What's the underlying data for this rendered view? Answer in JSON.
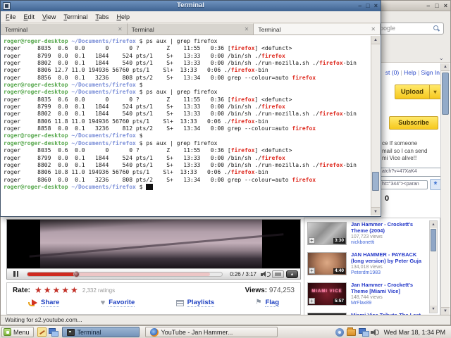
{
  "terminal": {
    "title": "Terminal",
    "menu_items": [
      "File",
      "Edit",
      "View",
      "Terminal",
      "Tabs",
      "Help"
    ],
    "tabs": [
      {
        "label": "Terminal"
      },
      {
        "label": "Terminal"
      },
      {
        "label": "Terminal"
      }
    ],
    "lines": [
      [
        [
          "roger@roger-desktop",
          "g"
        ],
        [
          " ",
          ""
        ],
        [
          "~/Documents/firefox",
          "b"
        ],
        [
          " $ ps aux | grep firefox",
          ""
        ]
      ],
      [
        [
          "roger     8035  0.6  0.0      0      0 ?        Z    11:55   0:36 [",
          ""
        ],
        [
          "firefox",
          "r"
        ],
        [
          "] <defunct>",
          ""
        ]
      ],
      [
        [
          "roger     8799  0.0  0.1   1844    524 pts/1    S+   13:33   0:00 /bin/sh ./",
          ""
        ],
        [
          "firefox",
          "r"
        ]
      ],
      [
        [
          "roger     8802  0.0  0.1   1844    540 pts/1    S+   13:33   0:00 /bin/sh ./run-mozilla.sh ./",
          ""
        ],
        [
          "firefox",
          "r"
        ],
        [
          "-bin",
          ""
        ]
      ],
      [
        [
          "roger     8806 12.7 11.0 194936 56760 pts/1    Sl+  13:33   0:06 ./",
          ""
        ],
        [
          "firefox",
          "r"
        ],
        [
          "-bin",
          ""
        ]
      ],
      [
        [
          "roger     8856  0.0  0.1   3236    808 pts/2    S+   13:34   0:00 grep --colour=auto ",
          ""
        ],
        [
          "firefox",
          "r"
        ]
      ],
      [
        [
          "roger@roger-desktop",
          "g"
        ],
        [
          " ",
          ""
        ],
        [
          "~/Documents/firefox",
          "b"
        ],
        [
          " $",
          ""
        ]
      ],
      [
        [
          "roger@roger-desktop",
          "g"
        ],
        [
          " ",
          ""
        ],
        [
          "~/Documents/firefox",
          "b"
        ],
        [
          " $ ps aux | grep firefox",
          ""
        ]
      ],
      [
        [
          "roger     8035  0.6  0.0      0      0 ?        Z    11:55   0:36 [",
          ""
        ],
        [
          "firefox",
          "r"
        ],
        [
          "] <defunct>",
          ""
        ]
      ],
      [
        [
          "roger     8799  0.0  0.1   1844    524 pts/1    S+   13:33   0:00 /bin/sh ./",
          ""
        ],
        [
          "firefox",
          "r"
        ]
      ],
      [
        [
          "roger     8802  0.0  0.1   1844    540 pts/1    S+   13:33   0:00 /bin/sh ./run-mozilla.sh ./",
          ""
        ],
        [
          "firefox",
          "r"
        ],
        [
          "-bin",
          ""
        ]
      ],
      [
        [
          "roger     8806 11.8 11.0 194936 56760 pts/1    Sl+  13:33   0:06 ./",
          ""
        ],
        [
          "firefox",
          "r"
        ],
        [
          "-bin",
          ""
        ]
      ],
      [
        [
          "roger     8858  0.0  0.1   3236    812 pts/2    S+   13:34   0:00 grep --colour=auto ",
          ""
        ],
        [
          "firefox",
          "r"
        ]
      ],
      [
        [
          "roger@roger-desktop",
          "g"
        ],
        [
          " ",
          ""
        ],
        [
          "~/Documents/firefox",
          "b"
        ],
        [
          " $",
          ""
        ]
      ],
      [
        [
          "roger@roger-desktop",
          "g"
        ],
        [
          " ",
          ""
        ],
        [
          "~/Documents/firefox",
          "b"
        ],
        [
          " $ ps aux | grep firefox",
          ""
        ]
      ],
      [
        [
          "roger     8035  0.6  0.0      0      0 ?        Z    11:55   0:36 [",
          ""
        ],
        [
          "firefox",
          "r"
        ],
        [
          "] <defunct>",
          ""
        ]
      ],
      [
        [
          "roger     8799  0.0  0.1   1844    524 pts/1    S+   13:33   0:00 /bin/sh ./",
          ""
        ],
        [
          "firefox",
          "r"
        ]
      ],
      [
        [
          "roger     8802  0.0  0.1   1844    540 pts/1    S+   13:33   0:00 /bin/sh ./run-mozilla.sh ./",
          ""
        ],
        [
          "firefox",
          "r"
        ],
        [
          "-bin",
          ""
        ]
      ],
      [
        [
          "roger     8806 10.8 11.0 194936 56760 pts/1    Sl+  13:33   0:06 ./",
          ""
        ],
        [
          "firefox",
          "r"
        ],
        [
          "-bin",
          ""
        ]
      ],
      [
        [
          "roger     8860  0.0  0.1   3236    808 pts/2    S+   13:34   0:00 grep --colour=auto ",
          ""
        ],
        [
          "firefox",
          "r"
        ]
      ],
      [
        [
          "roger@roger-desktop",
          "g"
        ],
        [
          " ",
          ""
        ],
        [
          "~/Documents/firefox",
          "b"
        ],
        [
          " $ ",
          ""
        ],
        [
          "  ",
          "cur"
        ]
      ]
    ]
  },
  "browser": {
    "search_text": "oogle",
    "header_links": [
      "st (0)",
      "Help",
      "Sign In"
    ],
    "upload_label": "Upload",
    "subscribe_label": "Subscribe",
    "description_lines": [
      "ce If someone",
      "mail so I can send",
      "mi Vice alive!!"
    ],
    "url_value": "atch?v=47XaK4",
    "embed_value": "ht=\"344\"><paran",
    "partial_count": "0",
    "player": {
      "time": "0:26 / 3:17"
    },
    "rate": {
      "label": "Rate:",
      "stars": "★★★★★",
      "ratings": "2,332 ratings",
      "views_label": "Views:",
      "views_value": "974,253"
    },
    "actions": [
      {
        "label": "Share",
        "icon": "share-icon",
        "cls": "ic-share"
      },
      {
        "label": "Favorite",
        "icon": "favorite-icon",
        "cls": "ic-heart",
        "glyph": "♥"
      },
      {
        "label": "Playlists",
        "icon": "playlists-icon",
        "cls": "ic-list"
      },
      {
        "label": "Flag",
        "icon": "flag-icon",
        "cls": "ic-flag",
        "glyph": "⚑"
      }
    ],
    "related": [
      {
        "title": "Jan Hammer - Crockett's Theme (2004)",
        "views": "107,723 views",
        "user": "nickbonetti",
        "duration": "3:30",
        "thumb": "th-t1",
        "thumb_text": ""
      },
      {
        "title": "JAN HAMMER - PAYBACK (long version) by Peter Guja",
        "views": "134,018 views",
        "user": "Peterdm1983",
        "duration": "4:40",
        "thumb": "th-t2",
        "thumb_text": ""
      },
      {
        "title": "Jan Hammer - Crockett's Theme [Miami Vice]",
        "views": "148,744 views",
        "user": "MrFlax89",
        "duration": "5:57",
        "thumb": "th-t3",
        "thumb_text": "MIAMI VICE"
      },
      {
        "title": "Miami Vice Tribute-The Last",
        "views": "",
        "user": "",
        "duration": "",
        "thumb": "th-t4",
        "thumb_text": ""
      }
    ],
    "status_text": "Waiting for s2.youtube.com..."
  },
  "taskbar": {
    "menu_label": "Menu",
    "tasks": [
      {
        "label": "Terminal"
      },
      {
        "label": "YouTube - Jan Hammer..."
      }
    ],
    "clock": "Wed Mar 18,  1:34 PM"
  },
  "colors": {
    "titlebar_blue": "#4e76a8",
    "youtube_link": "#2438c8",
    "button_yellow": "#f6c81e",
    "prompt_green": "#57a84d",
    "path_blue": "#7b8fd8",
    "grep_match_red": "#de2b20"
  }
}
